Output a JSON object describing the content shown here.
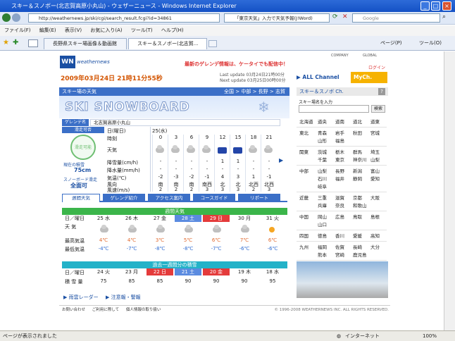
{
  "window": {
    "title": "スキー＆スノボー(北志賀高原小丸山) - ウェザーニュース - Windows Internet Explorer"
  },
  "address": {
    "url": "http://weathernews.jp/ski/cgi/search_result.fcgi?id=34861",
    "search_text": "「東京天気」入力で天気予報(J!Word)",
    "search_placeholder": "Google"
  },
  "menu": [
    "ファイル(F)",
    "編集(E)",
    "表示(V)",
    "お気に入り(A)",
    "ツール(T)",
    "ヘルプ(H)"
  ],
  "tabs": [
    "長野県スキー場画像＆動画館",
    "スキー＆スノボー(北志賀..."
  ],
  "toolbar_right": [
    "ページ(P)",
    "ツール(O)"
  ],
  "site": {
    "logo": "weathernews",
    "banner": "最新のゲレンデ情報は、ケータイでも配信中！",
    "company": "COMPANY",
    "global": "GLOBAL",
    "login": "ログイン",
    "date": "2009年03月24日 21時11分55秒",
    "last_update": "Last update 03月24日21時00分",
    "next_update": "Next update 03月25日00時00分",
    "all_channel": "ALL Channel",
    "my_ch": "MyCh."
  },
  "ski": {
    "section_title": "スキー場の天気",
    "crumbs": [
      "全国",
      "中部",
      "長野",
      "志賀"
    ],
    "banner_text": "SKI SNOWBOARD",
    "gelande_label": "ゲレンデ名",
    "gelande_name": "北志賀高原小丸山",
    "status": "滑走可否",
    "status_icon_text": "滑走可能",
    "depth_label": "現在の積雪",
    "depth": "75cm",
    "sboard_label": "スノーボード滑走",
    "sboard": "全面可",
    "row_labels": [
      "日(曜日)",
      "時刻",
      "天気",
      "降雪量(cm/h)",
      "降水量(mm/h)",
      "気温(℃)",
      "風向",
      "風速(m/s)"
    ],
    "day": "25(水)",
    "hours": [
      "0",
      "3",
      "6",
      "9",
      "12",
      "15",
      "18",
      "21"
    ],
    "weather": [
      "cloud",
      "cloud",
      "cloud",
      "cloud",
      "snow",
      "snow",
      "cloud",
      "cloud"
    ],
    "snowfall": [
      "-",
      "-",
      "-",
      "-",
      "1",
      "1",
      "-",
      "-"
    ],
    "precip": [
      "-",
      "-",
      "-",
      "-",
      "-",
      "-",
      "-",
      "-"
    ],
    "temp": [
      "-2",
      "-3",
      "-2",
      "-1",
      "4",
      "3",
      "1",
      "-1"
    ],
    "wind_dir": [
      "南",
      "南",
      "南",
      "南西",
      "北",
      "北",
      "北西",
      "北西"
    ],
    "wind_speed": [
      "2",
      "2",
      "2",
      "3",
      "3",
      "3",
      "2",
      "3"
    ]
  },
  "tabs2": [
    "週間天気",
    "ゲレンデ紹介",
    "アクセス案内",
    "コースガイド",
    "リポート"
  ],
  "weekly": {
    "title": "週間天気",
    "labels": [
      "日／曜日",
      "天 気",
      "最高気温",
      "最低気温"
    ],
    "days": [
      "25 水",
      "26 木",
      "27 金",
      "28 土",
      "29 日",
      "30 月",
      "31 火"
    ],
    "weather": [
      "cloud",
      "cloud",
      "cloud",
      "cloud",
      "cloud",
      "cloud",
      "sun"
    ],
    "high": [
      "4℃",
      "4℃",
      "3℃",
      "5℃",
      "6℃",
      "7℃",
      "6℃"
    ],
    "low": [
      "-4℃",
      "-7℃",
      "-8℃",
      "-8℃",
      "-7℃",
      "-6℃",
      "-6℃"
    ],
    "colors": {
      "sat": "#5b8be0",
      "sun": "#e43b3b"
    }
  },
  "history": {
    "title": "過去一週間分の積雪",
    "labels": [
      "日／曜日",
      "積 雪 量"
    ],
    "days": [
      "24 火",
      "23 月",
      "22 日",
      "21 土",
      "20 金",
      "19 木",
      "18 水"
    ],
    "values": [
      "75",
      "85",
      "85",
      "90",
      "90",
      "90",
      "95"
    ]
  },
  "links": [
    "雨雲レーダー",
    "注意報・警報"
  ],
  "footer": {
    "links": [
      "お問い合わせ",
      "ご利用に際して",
      "個人情報の取り扱い"
    ],
    "copyright": "© 1996-2008 WEATHERNEWS INC. ALL RIGHTS RESERVED."
  },
  "sidebar": {
    "title": "スキー＆スノボ Ch.",
    "search_label": "スキー場名を入力",
    "search_btn": "検索",
    "regions": [
      {
        "name": "北海道",
        "items": [
          "道央",
          "道南",
          "道北",
          "道東"
        ]
      },
      {
        "name": "東北",
        "items": [
          "青森",
          "岩手",
          "秋田",
          "宮城",
          "山形",
          "福島"
        ]
      },
      {
        "name": "関東",
        "items": [
          "茨城",
          "栃木",
          "群馬",
          "埼玉",
          "千葉",
          "東京",
          "神奈川",
          "山梨"
        ]
      },
      {
        "name": "中部",
        "items": [
          "山梨",
          "長野",
          "新潟",
          "富山",
          "石川",
          "福井",
          "静岡",
          "愛知",
          "岐阜"
        ]
      },
      {
        "name": "近畿",
        "items": [
          "三重",
          "滋賀",
          "京都",
          "大阪",
          "兵庫",
          "奈良",
          "和歌山"
        ]
      },
      {
        "name": "中国",
        "items": [
          "岡山",
          "広島",
          "鳥取",
          "島根",
          "山口"
        ]
      },
      {
        "name": "四国",
        "items": [
          "徳島",
          "香川",
          "愛媛",
          "高知"
        ]
      },
      {
        "name": "九州",
        "items": [
          "福岡",
          "佐賀",
          "長崎",
          "大分",
          "熊本",
          "宮崎",
          "鹿児島"
        ]
      }
    ]
  },
  "status": {
    "text": "ページが表示されました",
    "zone": "インターネット",
    "zoom": "100%"
  }
}
